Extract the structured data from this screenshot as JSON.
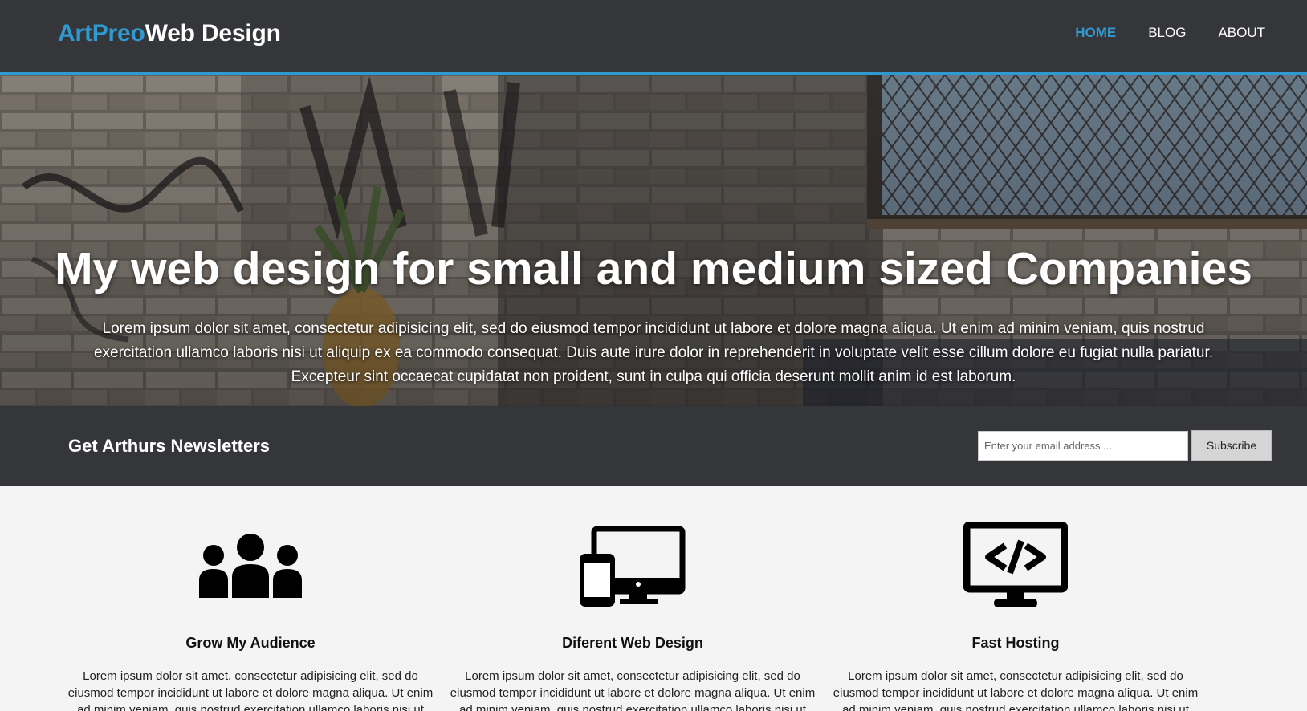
{
  "header": {
    "logo_accent": "ArtPreo",
    "logo_rest": "Web Design",
    "nav": [
      {
        "label": "HOME"
      },
      {
        "label": "BLOG"
      },
      {
        "label": "ABOUT"
      }
    ]
  },
  "hero": {
    "title": "My web design for small and medium sized Companies",
    "text": "Lorem ipsum dolor sit amet, consectetur adipisicing elit, sed do eiusmod tempor incididunt ut labore et dolore magna aliqua. Ut enim ad minim veniam, quis nostrud exercitation ullamco laboris nisi ut aliquip ex ea commodo consequat. Duis aute irure dolor in reprehenderit in voluptate velit esse cillum dolore eu fugiat nulla pariatur. Excepteur sint occaecat cupidatat non proident, sunt in culpa qui officia deserunt mollit anim id est laborum."
  },
  "newsletter": {
    "title": "Get Arthurs Newsletters",
    "email_placeholder": "Enter your email address ...",
    "subscribe_label": "Subscribe"
  },
  "features": [
    {
      "icon": "audience-icon",
      "title": "Grow My Audience",
      "text": "Lorem ipsum dolor sit amet, consectetur adipisicing elit, sed do eiusmod tempor incididunt ut labore et dolore magna aliqua. Ut enim ad minim veniam, quis nostrud exercitation ullamco laboris nisi ut"
    },
    {
      "icon": "devices-icon",
      "title": "Diferent Web Design",
      "text": "Lorem ipsum dolor sit amet, consectetur adipisicing elit, sed do eiusmod tempor incididunt ut labore et dolore magna aliqua. Ut enim ad minim veniam, quis nostrud exercitation ullamco laboris nisi ut"
    },
    {
      "icon": "code-monitor-icon",
      "title": "Fast Hosting",
      "text": "Lorem ipsum dolor sit amet, consectetur adipisicing elit, sed do eiusmod tempor incididunt ut labore et dolore magna aliqua. Ut enim ad minim veniam, quis nostrud exercitation ullamco laboris nisi ut"
    }
  ],
  "colors": {
    "accent": "#2f9ad0",
    "header_bg": "#35363a",
    "page_bg": "#f4f4f4"
  }
}
